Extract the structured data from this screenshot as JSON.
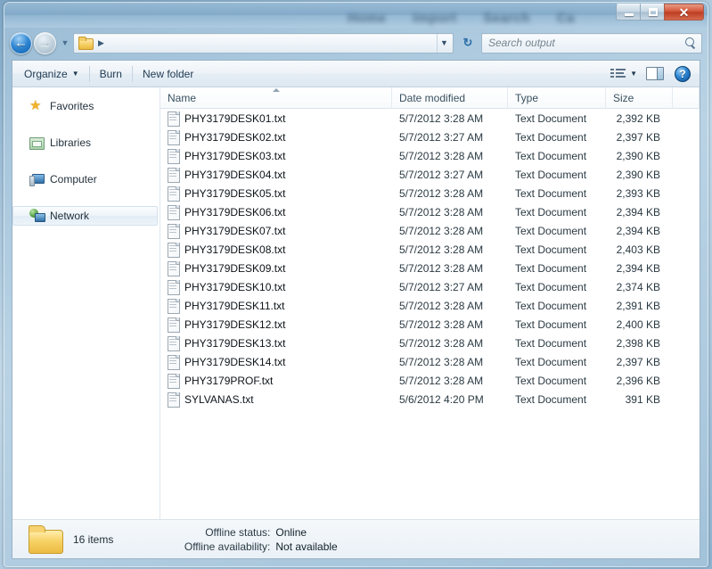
{
  "window": {
    "ghost_titles": [
      "Home",
      "Import",
      "Search",
      "Ca"
    ],
    "buttons": {
      "minimize": "minimize-button",
      "maximize": "maximize-button",
      "close_glyph": "✕"
    }
  },
  "navbar": {
    "back_glyph": "←",
    "forward_glyph": "→",
    "history_glyph": "▼",
    "address_dropdown_glyph": "▼",
    "refresh_glyph": "↻",
    "breadcrumb_separator": "▶",
    "breadcrumb_text": ""
  },
  "search": {
    "placeholder": "Search output",
    "value": ""
  },
  "toolbar": {
    "organize_label": "Organize",
    "organize_caret": "▼",
    "burn_label": "Burn",
    "new_folder_label": "New folder",
    "view_caret": "▼",
    "help_glyph": "?"
  },
  "sidebar": {
    "items": [
      {
        "label": "Favorites",
        "icon": "star-icon",
        "selected": false
      },
      {
        "label": "Libraries",
        "icon": "libraries-icon",
        "selected": false
      },
      {
        "label": "Computer",
        "icon": "computer-icon",
        "selected": false
      },
      {
        "label": "Network",
        "icon": "network-icon",
        "selected": true
      }
    ]
  },
  "filelist": {
    "columns": [
      {
        "key": "name",
        "label": "Name",
        "sorted": true,
        "sort_direction": "ascending"
      },
      {
        "key": "date",
        "label": "Date modified",
        "sorted": false
      },
      {
        "key": "type",
        "label": "Type",
        "sorted": false
      },
      {
        "key": "size",
        "label": "Size",
        "sorted": false
      }
    ],
    "rows": [
      {
        "name": "PHY3179DESK01.txt",
        "date": "5/7/2012 3:28 AM",
        "type": "Text Document",
        "size": "2,392 KB"
      },
      {
        "name": "PHY3179DESK02.txt",
        "date": "5/7/2012 3:27 AM",
        "type": "Text Document",
        "size": "2,397 KB"
      },
      {
        "name": "PHY3179DESK03.txt",
        "date": "5/7/2012 3:28 AM",
        "type": "Text Document",
        "size": "2,390 KB"
      },
      {
        "name": "PHY3179DESK04.txt",
        "date": "5/7/2012 3:27 AM",
        "type": "Text Document",
        "size": "2,390 KB"
      },
      {
        "name": "PHY3179DESK05.txt",
        "date": "5/7/2012 3:28 AM",
        "type": "Text Document",
        "size": "2,393 KB"
      },
      {
        "name": "PHY3179DESK06.txt",
        "date": "5/7/2012 3:28 AM",
        "type": "Text Document",
        "size": "2,394 KB"
      },
      {
        "name": "PHY3179DESK07.txt",
        "date": "5/7/2012 3:28 AM",
        "type": "Text Document",
        "size": "2,394 KB"
      },
      {
        "name": "PHY3179DESK08.txt",
        "date": "5/7/2012 3:28 AM",
        "type": "Text Document",
        "size": "2,403 KB"
      },
      {
        "name": "PHY3179DESK09.txt",
        "date": "5/7/2012 3:28 AM",
        "type": "Text Document",
        "size": "2,394 KB"
      },
      {
        "name": "PHY3179DESK10.txt",
        "date": "5/7/2012 3:27 AM",
        "type": "Text Document",
        "size": "2,374 KB"
      },
      {
        "name": "PHY3179DESK11.txt",
        "date": "5/7/2012 3:28 AM",
        "type": "Text Document",
        "size": "2,391 KB"
      },
      {
        "name": "PHY3179DESK12.txt",
        "date": "5/7/2012 3:28 AM",
        "type": "Text Document",
        "size": "2,400 KB"
      },
      {
        "name": "PHY3179DESK13.txt",
        "date": "5/7/2012 3:28 AM",
        "type": "Text Document",
        "size": "2,398 KB"
      },
      {
        "name": "PHY3179DESK14.txt",
        "date": "5/7/2012 3:28 AM",
        "type": "Text Document",
        "size": "2,397 KB"
      },
      {
        "name": "PHY3179PROF.txt",
        "date": "5/7/2012 3:28 AM",
        "type": "Text Document",
        "size": "2,396 KB"
      },
      {
        "name": "SYLVANAS.txt",
        "date": "5/6/2012 4:20 PM",
        "type": "Text Document",
        "size": "391 KB"
      }
    ]
  },
  "statusbar": {
    "item_count": "16 items",
    "offline_status_label": "Offline status:",
    "offline_status_value": "Online",
    "offline_availability_label": "Offline availability:",
    "offline_availability_value": "Not available"
  },
  "colors": {
    "accent": "#2f86d2",
    "close_button": "#c74a2c",
    "folder": "#f6cf62",
    "selection": "#e2ecf5"
  }
}
